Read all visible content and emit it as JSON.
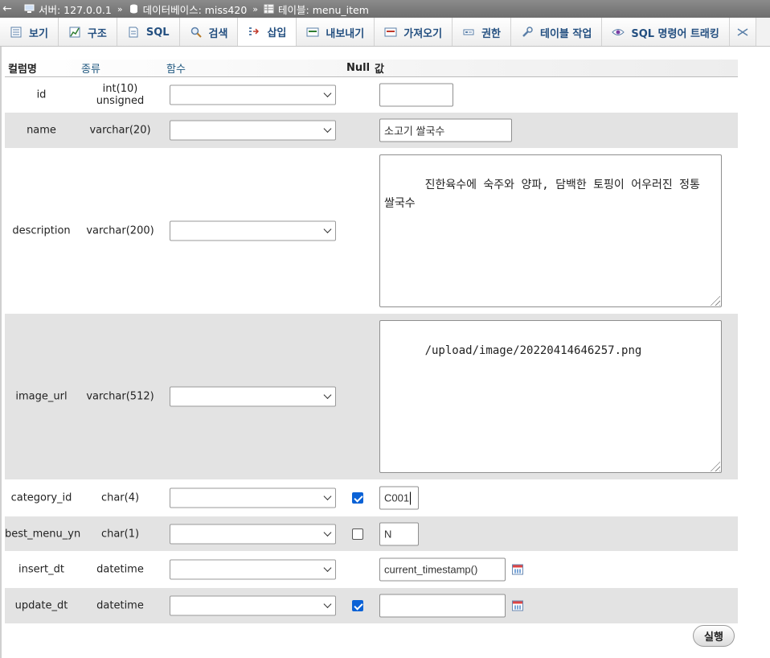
{
  "breadcrumb": {
    "back_symbol": "←",
    "server": "서버: 127.0.0.1",
    "sep1": "»",
    "database": "데이터베이스: miss420",
    "sep2": "»",
    "table": "테이블: menu_item"
  },
  "tabs": [
    {
      "label": "보기",
      "icon": "browse-icon"
    },
    {
      "label": "구조",
      "icon": "structure-icon"
    },
    {
      "label": "SQL",
      "icon": "sql-icon"
    },
    {
      "label": "검색",
      "icon": "search-icon"
    },
    {
      "label": "삽입",
      "icon": "insert-icon",
      "active": true
    },
    {
      "label": "내보내기",
      "icon": "export-icon"
    },
    {
      "label": "가져오기",
      "icon": "import-icon"
    },
    {
      "label": "권한",
      "icon": "privileges-icon"
    },
    {
      "label": "테이블 작업",
      "icon": "operations-icon"
    },
    {
      "label": "SQL 명령어 트래킹",
      "icon": "tracking-icon"
    }
  ],
  "table_header": {
    "column": "컬럼명",
    "type": "종류",
    "function": "함수",
    "null": "Null",
    "value": "값"
  },
  "rows": [
    {
      "name": "id",
      "type": "int(10) unsigned",
      "function": "",
      "null_checkbox": false,
      "null_checked": false,
      "value": ""
    },
    {
      "name": "name",
      "type": "varchar(20)",
      "function": "",
      "null_checkbox": false,
      "null_checked": false,
      "value": "소고기 쌀국수"
    },
    {
      "name": "description",
      "type": "varchar(200)",
      "function": "",
      "null_checkbox": false,
      "null_checked": false,
      "value": "진한육수에 숙주와 양파, 담백한 토핑이 어우러진 정통 쌀국수"
    },
    {
      "name": "image_url",
      "type": "varchar(512)",
      "function": "",
      "null_checkbox": false,
      "null_checked": false,
      "value": "/upload/image/20220414646257.png"
    },
    {
      "name": "category_id",
      "type": "char(4)",
      "function": "",
      "null_checkbox": true,
      "null_checked": true,
      "value": "C001"
    },
    {
      "name": "best_menu_yn",
      "type": "char(1)",
      "function": "",
      "null_checkbox": true,
      "null_checked": false,
      "value": "N"
    },
    {
      "name": "insert_dt",
      "type": "datetime",
      "function": "",
      "null_checkbox": false,
      "null_checked": false,
      "value": "current_timestamp()"
    },
    {
      "name": "update_dt",
      "type": "datetime",
      "function": "",
      "null_checkbox": true,
      "null_checked": true,
      "value": ""
    }
  ],
  "go_button": "실행",
  "colors": {
    "tab_text": "#234f80",
    "row_alt": "#e3e3e3",
    "checkbox": "#0b62d6"
  }
}
